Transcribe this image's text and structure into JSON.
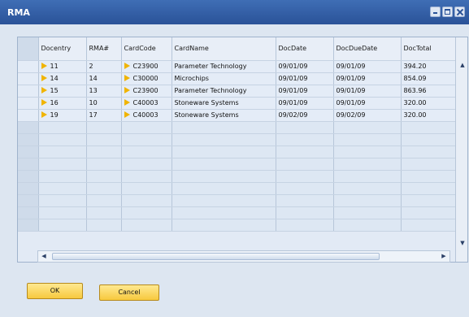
{
  "window": {
    "title": "RMA"
  },
  "grid": {
    "columns": [
      "Docentry",
      "RMA#",
      "CardCode",
      "CardName",
      "DocDate",
      "DocDueDate",
      "DocTotal"
    ],
    "rows": [
      [
        "11",
        "2",
        "C23900",
        "Parameter Technology",
        "09/01/09",
        "09/01/09",
        "394.20"
      ],
      [
        "14",
        "14",
        "C30000",
        "Microchips",
        "09/01/09",
        "09/01/09",
        "854.09"
      ],
      [
        "15",
        "13",
        "C23900",
        "Parameter Technology",
        "09/01/09",
        "09/01/09",
        "863.96"
      ],
      [
        "16",
        "10",
        "C40003",
        "Stoneware Systems",
        "09/01/09",
        "09/01/09",
        "320.00"
      ],
      [
        "19",
        "17",
        "C40003",
        "Stoneware Systems",
        "09/02/09",
        "09/02/09",
        "320.00"
      ]
    ],
    "empty_row_count": 9
  },
  "buttons": {
    "ok": "OK",
    "cancel": "Cancel"
  },
  "colors": {
    "titlebar": "#2a5298",
    "button": "#f7c93e",
    "link_arrow": "#f0b400"
  }
}
